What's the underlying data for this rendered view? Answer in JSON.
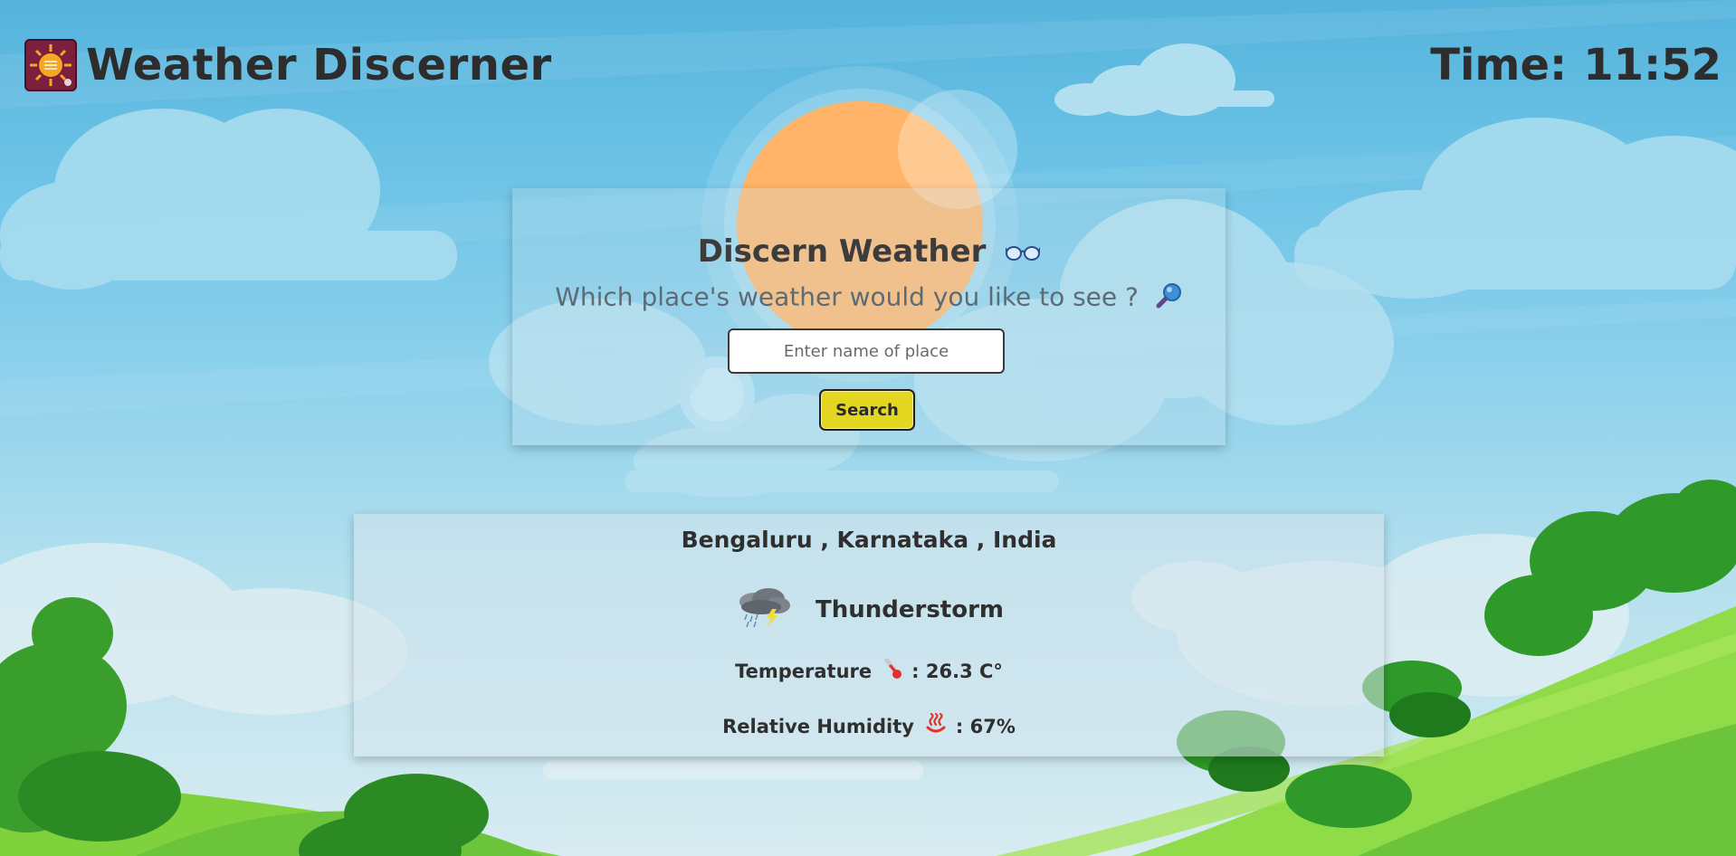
{
  "header": {
    "app_title": "Weather Discerner",
    "time_label": "Time:",
    "time_value": "11:52"
  },
  "search": {
    "title": "Discern Weather",
    "title_icon": "glasses-icon",
    "subtitle": "Which place's weather would you like to see ?",
    "subtitle_icon": "magnifier-icon",
    "input_placeholder": "Enter name of place",
    "input_value": "",
    "button_label": "Search"
  },
  "result": {
    "location": "Bengaluru , Karnataka , India",
    "condition": "Thunderstorm",
    "condition_icon": "thunderstorm-cloud-icon",
    "temperature_label": "Temperature",
    "temperature_icon": "thermometer-icon",
    "temperature_value": ": 26.3 C°",
    "humidity_label": "Relative Humidity",
    "humidity_icon": "hot-springs-icon",
    "humidity_value": ": 67%"
  },
  "colors": {
    "sky_top": "#55b3dc",
    "sun": "#ffb469",
    "button": "#e4d722",
    "logo_bg": "#7a1f3d",
    "hill_green": "#6cc43a"
  }
}
